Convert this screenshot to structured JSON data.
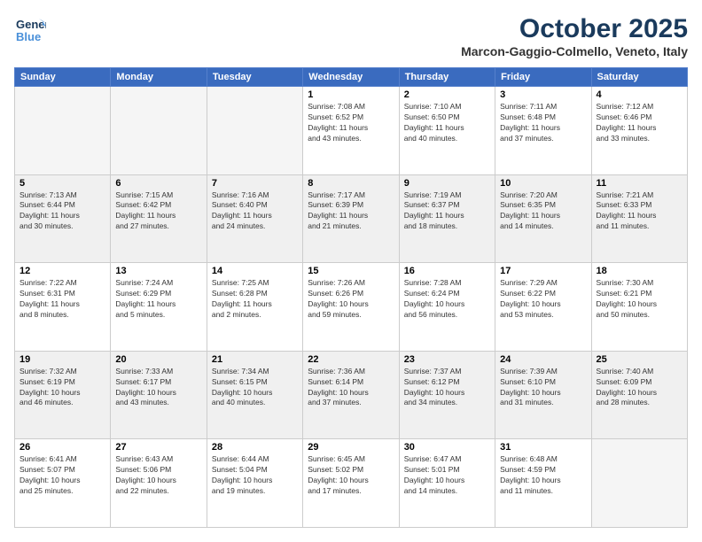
{
  "header": {
    "logo_line1": "General",
    "logo_line2": "Blue",
    "month": "October 2025",
    "location": "Marcon-Gaggio-Colmello, Veneto, Italy"
  },
  "weekdays": [
    "Sunday",
    "Monday",
    "Tuesday",
    "Wednesday",
    "Thursday",
    "Friday",
    "Saturday"
  ],
  "weeks": [
    [
      {
        "day": "",
        "info": ""
      },
      {
        "day": "",
        "info": ""
      },
      {
        "day": "",
        "info": ""
      },
      {
        "day": "1",
        "info": "Sunrise: 7:08 AM\nSunset: 6:52 PM\nDaylight: 11 hours\nand 43 minutes."
      },
      {
        "day": "2",
        "info": "Sunrise: 7:10 AM\nSunset: 6:50 PM\nDaylight: 11 hours\nand 40 minutes."
      },
      {
        "day": "3",
        "info": "Sunrise: 7:11 AM\nSunset: 6:48 PM\nDaylight: 11 hours\nand 37 minutes."
      },
      {
        "day": "4",
        "info": "Sunrise: 7:12 AM\nSunset: 6:46 PM\nDaylight: 11 hours\nand 33 minutes."
      }
    ],
    [
      {
        "day": "5",
        "info": "Sunrise: 7:13 AM\nSunset: 6:44 PM\nDaylight: 11 hours\nand 30 minutes."
      },
      {
        "day": "6",
        "info": "Sunrise: 7:15 AM\nSunset: 6:42 PM\nDaylight: 11 hours\nand 27 minutes."
      },
      {
        "day": "7",
        "info": "Sunrise: 7:16 AM\nSunset: 6:40 PM\nDaylight: 11 hours\nand 24 minutes."
      },
      {
        "day": "8",
        "info": "Sunrise: 7:17 AM\nSunset: 6:39 PM\nDaylight: 11 hours\nand 21 minutes."
      },
      {
        "day": "9",
        "info": "Sunrise: 7:19 AM\nSunset: 6:37 PM\nDaylight: 11 hours\nand 18 minutes."
      },
      {
        "day": "10",
        "info": "Sunrise: 7:20 AM\nSunset: 6:35 PM\nDaylight: 11 hours\nand 14 minutes."
      },
      {
        "day": "11",
        "info": "Sunrise: 7:21 AM\nSunset: 6:33 PM\nDaylight: 11 hours\nand 11 minutes."
      }
    ],
    [
      {
        "day": "12",
        "info": "Sunrise: 7:22 AM\nSunset: 6:31 PM\nDaylight: 11 hours\nand 8 minutes."
      },
      {
        "day": "13",
        "info": "Sunrise: 7:24 AM\nSunset: 6:29 PM\nDaylight: 11 hours\nand 5 minutes."
      },
      {
        "day": "14",
        "info": "Sunrise: 7:25 AM\nSunset: 6:28 PM\nDaylight: 11 hours\nand 2 minutes."
      },
      {
        "day": "15",
        "info": "Sunrise: 7:26 AM\nSunset: 6:26 PM\nDaylight: 10 hours\nand 59 minutes."
      },
      {
        "day": "16",
        "info": "Sunrise: 7:28 AM\nSunset: 6:24 PM\nDaylight: 10 hours\nand 56 minutes."
      },
      {
        "day": "17",
        "info": "Sunrise: 7:29 AM\nSunset: 6:22 PM\nDaylight: 10 hours\nand 53 minutes."
      },
      {
        "day": "18",
        "info": "Sunrise: 7:30 AM\nSunset: 6:21 PM\nDaylight: 10 hours\nand 50 minutes."
      }
    ],
    [
      {
        "day": "19",
        "info": "Sunrise: 7:32 AM\nSunset: 6:19 PM\nDaylight: 10 hours\nand 46 minutes."
      },
      {
        "day": "20",
        "info": "Sunrise: 7:33 AM\nSunset: 6:17 PM\nDaylight: 10 hours\nand 43 minutes."
      },
      {
        "day": "21",
        "info": "Sunrise: 7:34 AM\nSunset: 6:15 PM\nDaylight: 10 hours\nand 40 minutes."
      },
      {
        "day": "22",
        "info": "Sunrise: 7:36 AM\nSunset: 6:14 PM\nDaylight: 10 hours\nand 37 minutes."
      },
      {
        "day": "23",
        "info": "Sunrise: 7:37 AM\nSunset: 6:12 PM\nDaylight: 10 hours\nand 34 minutes."
      },
      {
        "day": "24",
        "info": "Sunrise: 7:39 AM\nSunset: 6:10 PM\nDaylight: 10 hours\nand 31 minutes."
      },
      {
        "day": "25",
        "info": "Sunrise: 7:40 AM\nSunset: 6:09 PM\nDaylight: 10 hours\nand 28 minutes."
      }
    ],
    [
      {
        "day": "26",
        "info": "Sunrise: 6:41 AM\nSunset: 5:07 PM\nDaylight: 10 hours\nand 25 minutes."
      },
      {
        "day": "27",
        "info": "Sunrise: 6:43 AM\nSunset: 5:06 PM\nDaylight: 10 hours\nand 22 minutes."
      },
      {
        "day": "28",
        "info": "Sunrise: 6:44 AM\nSunset: 5:04 PM\nDaylight: 10 hours\nand 19 minutes."
      },
      {
        "day": "29",
        "info": "Sunrise: 6:45 AM\nSunset: 5:02 PM\nDaylight: 10 hours\nand 17 minutes."
      },
      {
        "day": "30",
        "info": "Sunrise: 6:47 AM\nSunset: 5:01 PM\nDaylight: 10 hours\nand 14 minutes."
      },
      {
        "day": "31",
        "info": "Sunrise: 6:48 AM\nSunset: 4:59 PM\nDaylight: 10 hours\nand 11 minutes."
      },
      {
        "day": "",
        "info": ""
      }
    ]
  ]
}
